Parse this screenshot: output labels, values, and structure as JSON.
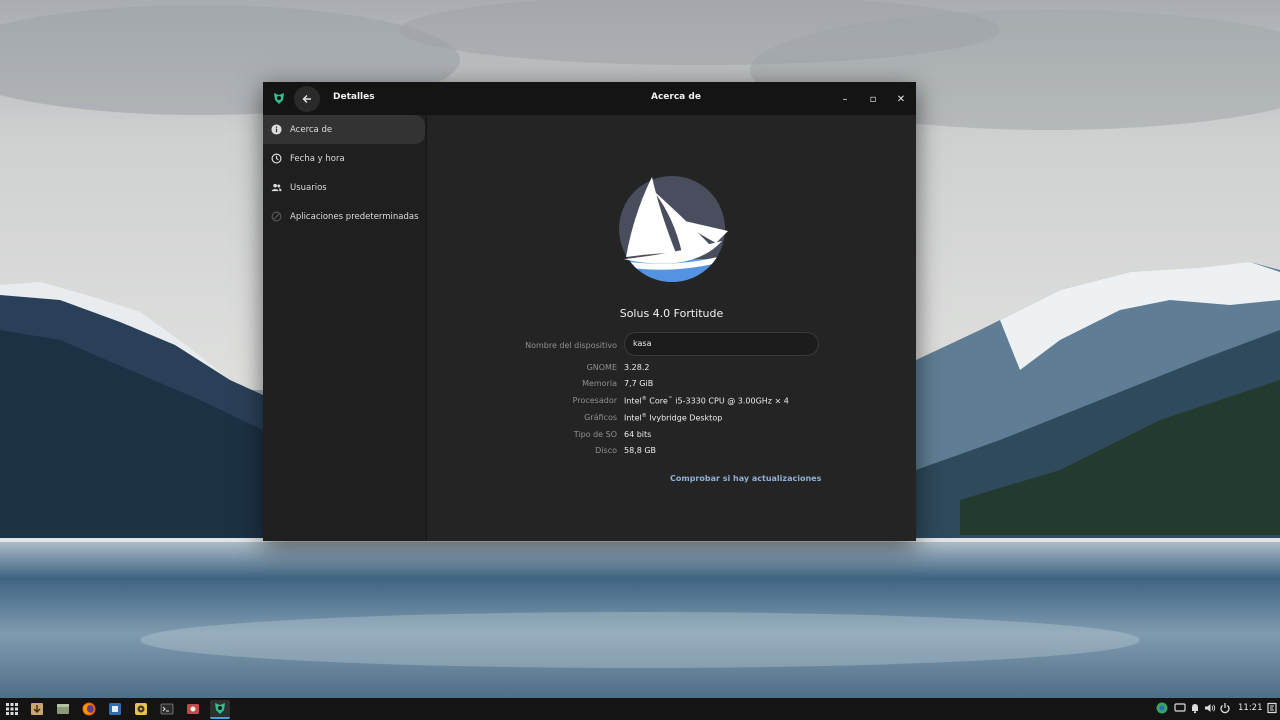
{
  "window": {
    "sidebar_title": "Detalles",
    "title": "Acerca de",
    "controls": {
      "minimize": "–",
      "maximize": "▫",
      "close": "✕"
    }
  },
  "sidebar": {
    "items": [
      {
        "label": "Acerca de",
        "icon": "info-icon"
      },
      {
        "label": "Fecha y hora",
        "icon": "clock-icon"
      },
      {
        "label": "Usuarios",
        "icon": "users-icon"
      },
      {
        "label": "Aplicaciones predeterminadas",
        "icon": "default-apps-icon"
      }
    ]
  },
  "about": {
    "os_name": "Solus 4.0 Fortitude",
    "device_name_label": "Nombre del dispositivo",
    "device_name_value": "kasa",
    "rows": [
      {
        "label": "GNOME",
        "value": "3.28.2"
      },
      {
        "label": "Memoria",
        "value": "7,7 GiB"
      },
      {
        "label": "Procesador",
        "value_parts": [
          "Intel",
          "®",
          " Core",
          "™",
          " i5-3330 CPU @ 3.00GHz × 4"
        ]
      },
      {
        "label": "Gráficos",
        "value_parts": [
          "Intel",
          "®",
          " Ivybridge Desktop"
        ]
      },
      {
        "label": "Tipo de SO",
        "value": "64 bits"
      },
      {
        "label": "Disco",
        "value": "58,8 GB"
      }
    ],
    "update_link": "Comprobar si hay actualizaciones"
  },
  "taskbar": {
    "clock": "11:21",
    "launchers": [
      "menu-grid-icon",
      "downloader-icon",
      "files-icon",
      "firefox-icon",
      "paint-icon",
      "rhythmbox-icon",
      "terminal-icon",
      "screen-recorder-icon",
      "settings-app-icon"
    ],
    "tray": [
      "browser-tray-icon",
      "chat-icon",
      "notification-icon",
      "volume-icon",
      "power-icon",
      "raven-icon"
    ]
  },
  "colors": {
    "accent": "#4aa0d8",
    "link": "#8fb0d3",
    "solus_blue": "#5294e2",
    "solus_dark": "#4a4d5e"
  }
}
